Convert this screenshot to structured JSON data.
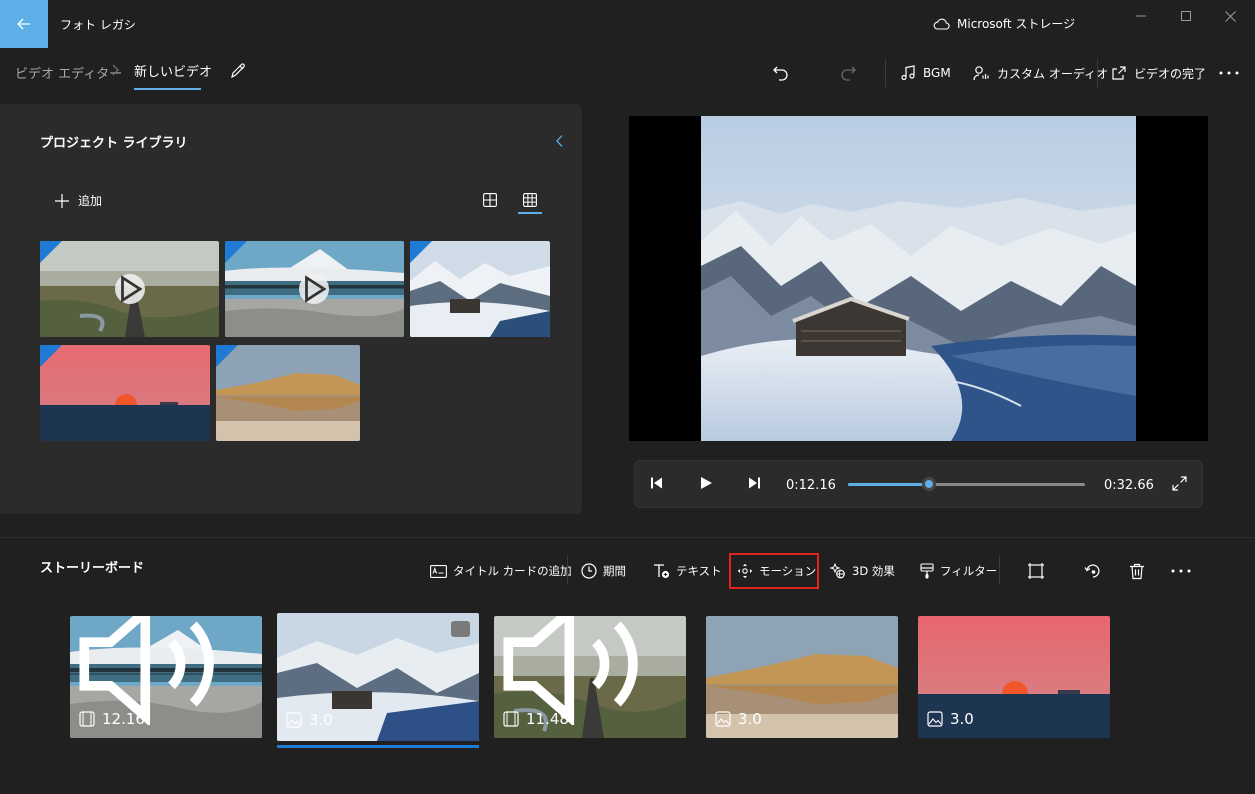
{
  "titlebar": {
    "app_title": "フォト レガシ",
    "storage_label": "Microsoft ストレージ"
  },
  "breadcrumb": {
    "parent": "ビデオ エディター",
    "current": "新しいビデオ"
  },
  "commands": {
    "bgm": "BGM",
    "custom_audio": "カスタム オーディオ",
    "finish_video": "ビデオの完了"
  },
  "library": {
    "title": "プロジェクト ライブラリ",
    "add_label": "追加"
  },
  "player": {
    "current_time": "0:12.16",
    "total_time": "0:32.66",
    "progress": 0.34
  },
  "storyboard": {
    "title": "ストーリーボード",
    "tools": {
      "title_card": "タイトル カードの追加",
      "duration": "期間",
      "text": "テキスト",
      "motion": "モーション",
      "effects_3d": "3D 効果",
      "filters": "フィルター"
    },
    "clips": [
      {
        "duration": "12.16",
        "type": "video",
        "audio": true
      },
      {
        "duration": "3.0",
        "type": "image",
        "audio": false,
        "selected": true
      },
      {
        "duration": "11.48",
        "type": "video",
        "audio": true
      },
      {
        "duration": "3.0",
        "type": "image",
        "audio": false
      },
      {
        "duration": "3.0",
        "type": "image",
        "audio": false
      }
    ]
  },
  "colors": {
    "accent": "#5eaee8",
    "background": "#202020",
    "panel": "#2b2b2b",
    "highlight_box": "#e0261c"
  }
}
